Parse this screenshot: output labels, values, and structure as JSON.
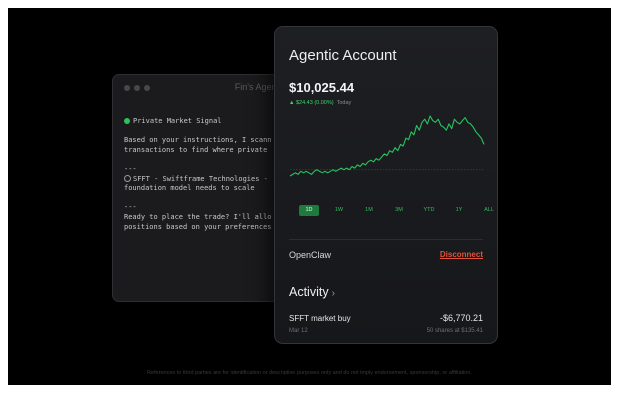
{
  "terminal": {
    "title": "Fin's Agent",
    "lines": [
      {
        "text": "Private Market Signal",
        "marker": "green"
      },
      {
        "text": ""
      },
      {
        "text": "Based on your instructions, I scann"
      },
      {
        "text": "transactions to find where private"
      },
      {
        "text": ""
      },
      {
        "text": "---"
      },
      {
        "text": "SFFT - Swiftframe Technologies -",
        "marker": "circle"
      },
      {
        "text": "foundation model needs to scale"
      },
      {
        "text": ""
      },
      {
        "text": "---"
      },
      {
        "text": "Ready to place the trade? I'll allo"
      },
      {
        "text": "positions based on your preferences"
      }
    ]
  },
  "account": {
    "heading": "Agentic Account",
    "balance": "$10,025.44",
    "change": "▲ $24.43 (0.00%)",
    "change_period": "Today",
    "tabs": [
      "1D",
      "1W",
      "1M",
      "3M",
      "YTD",
      "1Y",
      "ALL"
    ],
    "active_tab": "1D",
    "connector": "OpenClaw",
    "disconnect_label": "Disconnect",
    "activity_label": "Activity",
    "transaction": {
      "name": "SFFT market buy",
      "amount": "-$6,770.21",
      "date": "Mar 12",
      "detail": "50 shares at $135.41"
    }
  },
  "chart_data": {
    "type": "line",
    "series": [
      {
        "values": [
          2,
          3,
          4,
          3,
          5,
          4,
          5,
          4,
          3,
          5,
          6,
          5,
          4,
          5,
          4,
          5,
          6,
          5,
          6,
          7,
          6,
          7,
          6,
          8,
          7,
          9,
          8,
          10,
          9,
          11,
          12,
          11,
          13,
          12,
          14,
          16,
          15,
          18,
          17,
          20,
          18,
          22,
          21,
          26,
          25,
          30,
          28,
          34,
          31,
          36,
          38,
          35,
          40,
          37,
          36,
          38,
          34,
          33,
          31,
          35,
          32,
          38,
          36,
          35,
          37,
          39,
          36,
          35,
          33,
          30,
          28,
          26,
          22
        ]
      }
    ],
    "baseline": true
  },
  "colors": {
    "accent_green": "#27c45e",
    "disconnect_red": "#e0533a"
  },
  "footer": "References to third parties are for identification or descriptive purposes only and do not imply endorsement, sponsorship, or affiliation."
}
